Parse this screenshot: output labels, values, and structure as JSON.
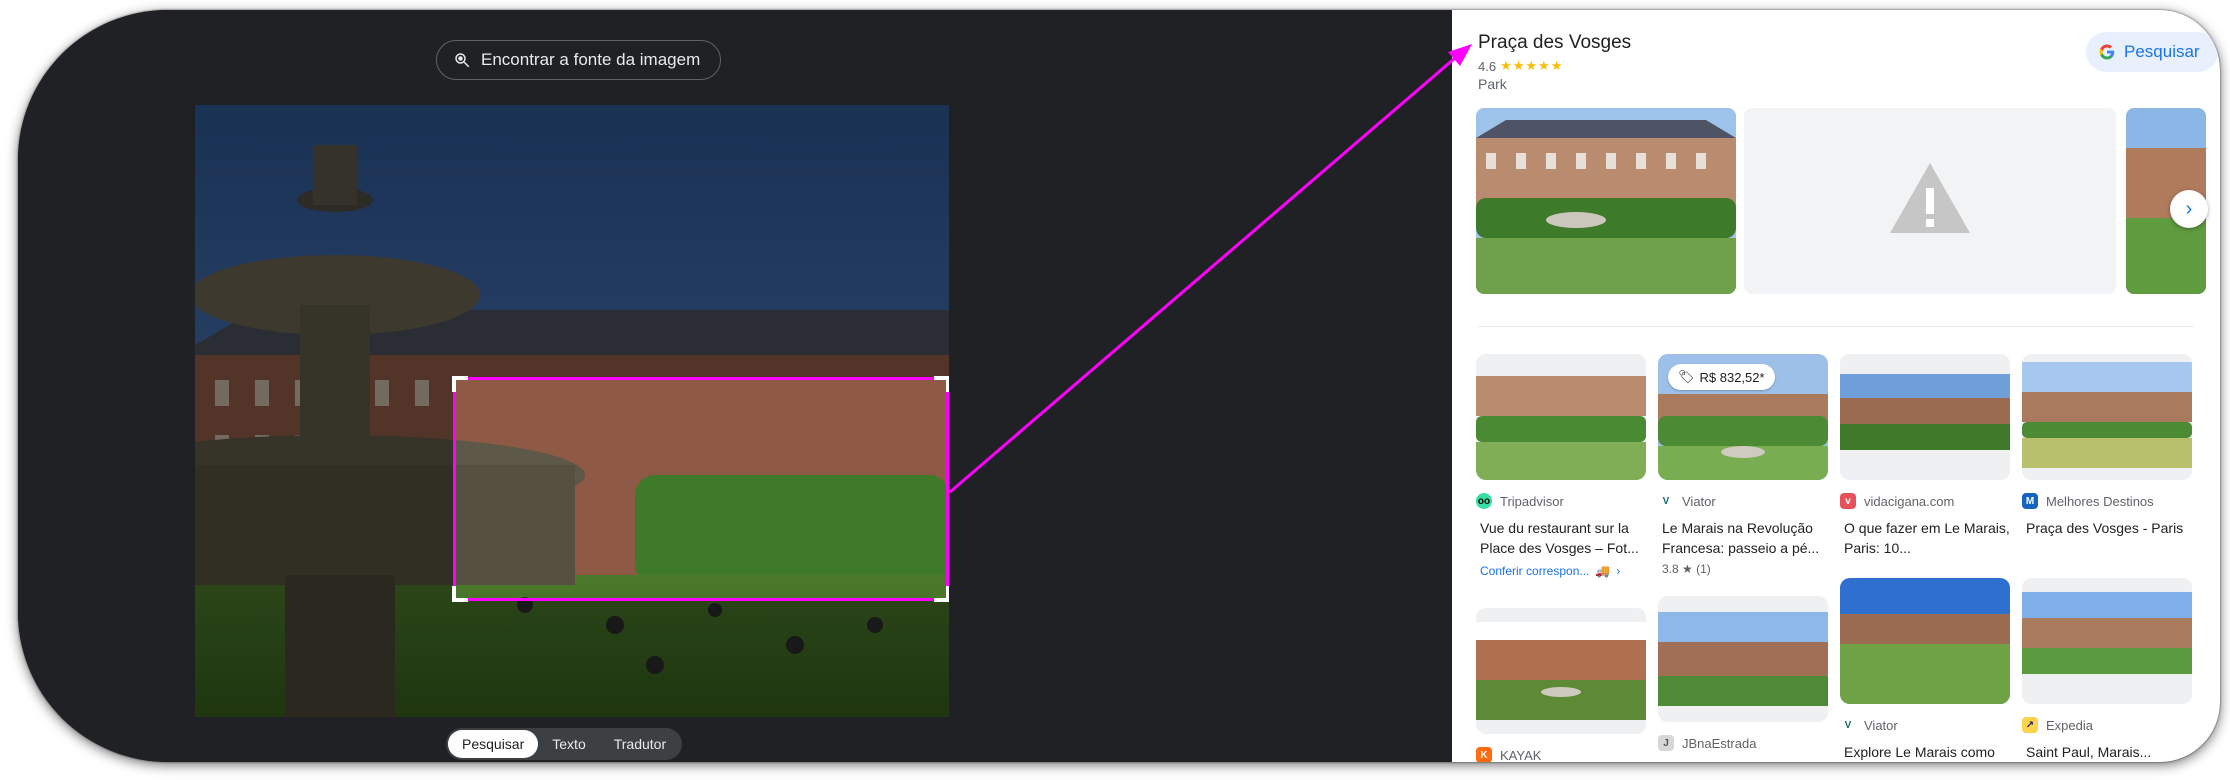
{
  "lens": {
    "find_source_label": "Encontrar a fonte da imagem",
    "tabs": [
      "Pesquisar",
      "Texto",
      "Tradutor"
    ],
    "active_tab": "Pesquisar"
  },
  "place": {
    "title": "Praça des Vosges",
    "rating": "4.6",
    "stars": "★★★★★",
    "type": "Park"
  },
  "search_button_label": "Pesquisar",
  "cards": [
    {
      "source": "Tripadvisor",
      "title": "Vue du restaurant sur la Place des Vosges – Fot...",
      "link": "Conferir correspon...",
      "icon_color": "#34e0a1",
      "icon_text": "oo"
    },
    {
      "source": "Viator",
      "title": "Le Marais na Revolução Francesa: passeio a pé...",
      "rating": "3.8 ★ (1)",
      "price": "R$ 832,52*",
      "icon_color": "#ffffff",
      "icon_text": "V"
    },
    {
      "source": "vidacigana.com",
      "title": "O que fazer em Le Marais, Paris: 10...",
      "icon_color": "#e8505b",
      "icon_text": "v"
    },
    {
      "source": "Melhores Destinos",
      "title": "Praça des Vosges - Paris",
      "icon_color": "#1565c0",
      "icon_text": "M"
    },
    {
      "source": "KAYAK",
      "title": "",
      "icon_color": "#ff690f",
      "icon_text": "K"
    },
    {
      "source": "JBnaEstrada",
      "title": "",
      "icon_color": "#d7d7d7",
      "icon_text": "J"
    },
    {
      "source": "Viator",
      "title": "Explore Le Marais como",
      "icon_color": "#ffffff",
      "icon_text": "V"
    },
    {
      "source": "Expedia",
      "title": "Saint Paul, Marais...",
      "icon_color": "#fcd34d",
      "icon_text": "↗"
    }
  ],
  "colors": {
    "lens_bg": "#202124",
    "accent_magenta": "#ff00ff",
    "google_blue": "#1a73e8",
    "star_yellow": "#fbbc04"
  }
}
